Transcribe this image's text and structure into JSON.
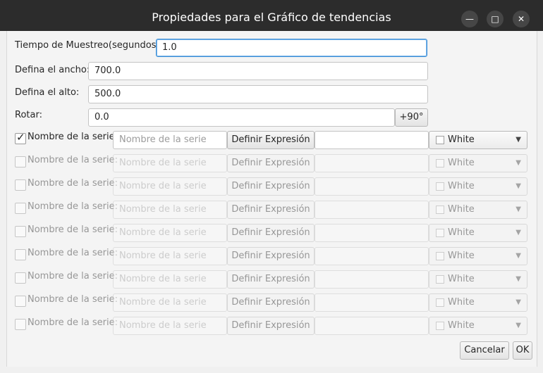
{
  "window": {
    "title": "Propiedades para el Gráfico de tendencias",
    "minimize": "—",
    "maximize": "□",
    "close": "✕"
  },
  "form": {
    "sample_label": "Tiempo de Muestreo(segundos):",
    "sample_value": "1.0",
    "width_label": "Defina el ancho:",
    "width_value": "700.0",
    "height_label": "Defina el alto:",
    "height_value": "500.0",
    "rotate_label": "Rotar:",
    "rotate_value": "0.0",
    "rotate_button": "+90°"
  },
  "series": [
    {
      "checked": true,
      "enabled": true,
      "label": "Nombre de la serie:",
      "placeholder": "Nombre de la serie",
      "button": "Definir Expresión",
      "expression": "",
      "color": "White"
    },
    {
      "checked": false,
      "enabled": false,
      "label": "Nombre de la serie:",
      "placeholder": "Nombre de la serie",
      "button": "Definir Expresión",
      "expression": "",
      "color": "White"
    },
    {
      "checked": false,
      "enabled": false,
      "label": "Nombre de la serie:",
      "placeholder": "Nombre de la serie",
      "button": "Definir Expresión",
      "expression": "",
      "color": "White"
    },
    {
      "checked": false,
      "enabled": false,
      "label": "Nombre de la serie:",
      "placeholder": "Nombre de la serie",
      "button": "Definir Expresión",
      "expression": "",
      "color": "White"
    },
    {
      "checked": false,
      "enabled": false,
      "label": "Nombre de la serie:",
      "placeholder": "Nombre de la serie",
      "button": "Definir Expresión",
      "expression": "",
      "color": "White"
    },
    {
      "checked": false,
      "enabled": false,
      "label": "Nombre de la serie:",
      "placeholder": "Nombre de la serie",
      "button": "Definir Expresión",
      "expression": "",
      "color": "White"
    },
    {
      "checked": false,
      "enabled": false,
      "label": "Nombre de la serie:",
      "placeholder": "Nombre de la serie",
      "button": "Definir Expresión",
      "expression": "",
      "color": "White"
    },
    {
      "checked": false,
      "enabled": false,
      "label": "Nombre de la serie:",
      "placeholder": "Nombre de la serie",
      "button": "Definir Expresión",
      "expression": "",
      "color": "White"
    },
    {
      "checked": false,
      "enabled": false,
      "label": "Nombre de la serie:",
      "placeholder": "Nombre de la serie",
      "button": "Definir Expresión",
      "expression": "",
      "color": "White"
    }
  ],
  "footer": {
    "cancel": "Cancelar",
    "ok": "OK"
  }
}
